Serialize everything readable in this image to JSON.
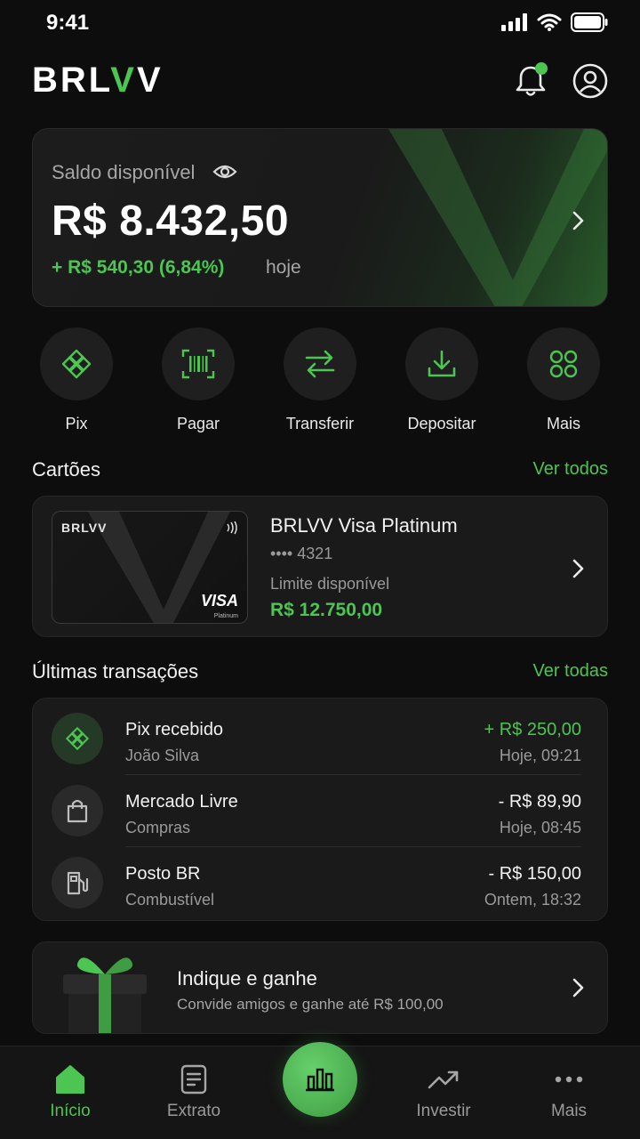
{
  "status_bar": {
    "time": "9:41"
  },
  "header": {
    "logo_prefix": "BRL",
    "logo_v1": "V",
    "logo_v2": "V"
  },
  "balance": {
    "label": "Saldo disponível",
    "amount": "R$ 8.432,50",
    "change": "+ R$ 540,30 (6,84%)",
    "period": "hoje"
  },
  "actions": [
    {
      "label": "Pix",
      "icon": "pix-icon"
    },
    {
      "label": "Pagar",
      "icon": "barcode-icon"
    },
    {
      "label": "Transferir",
      "icon": "transfer-icon"
    },
    {
      "label": "Depositar",
      "icon": "download-icon"
    },
    {
      "label": "Mais",
      "icon": "grid-icon"
    }
  ],
  "cards_section": {
    "title": "Cartões",
    "link": "Ver todos",
    "card": {
      "logo": "BRLVV",
      "brand": "VISA",
      "tier": "Platinum",
      "name": "BRLVV Visa Platinum",
      "number": "•••• 4321",
      "limit_label": "Limite disponível",
      "limit": "R$ 12.750,00"
    }
  },
  "transactions_section": {
    "title": "Últimas transações",
    "link": "Ver todas",
    "items": [
      {
        "title": "Pix recebido",
        "subtitle": "João Silva",
        "amount": "+ R$ 250,00",
        "time": "Hoje, 09:21",
        "icon": "pix-icon"
      },
      {
        "title": "Mercado Livre",
        "subtitle": "Compras",
        "amount": "- R$ 89,90",
        "time": "Hoje, 08:45",
        "icon": "shopping-bag-icon"
      },
      {
        "title": "Posto BR",
        "subtitle": "Combustível",
        "amount": "- R$ 150,00",
        "time": "Ontem, 18:32",
        "icon": "fuel-icon"
      }
    ]
  },
  "referral": {
    "title": "Indique e ganhe",
    "subtitle": "Convide amigos e ganhe até R$ 100,00",
    "icon": "gift-icon"
  },
  "bottom_nav": [
    {
      "label": "Início",
      "icon": "home-icon",
      "active": true
    },
    {
      "label": "Extrato",
      "icon": "document-icon",
      "active": false
    },
    {
      "label": "",
      "icon": "chart-icon",
      "active": false
    },
    {
      "label": "Investir",
      "icon": "trend-up-icon",
      "active": false
    },
    {
      "label": "Mais",
      "icon": "more-icon",
      "active": false
    }
  ],
  "colors": {
    "accent": "#4cc552",
    "background": "#0d0d0d",
    "card": "#1a1a1a"
  }
}
